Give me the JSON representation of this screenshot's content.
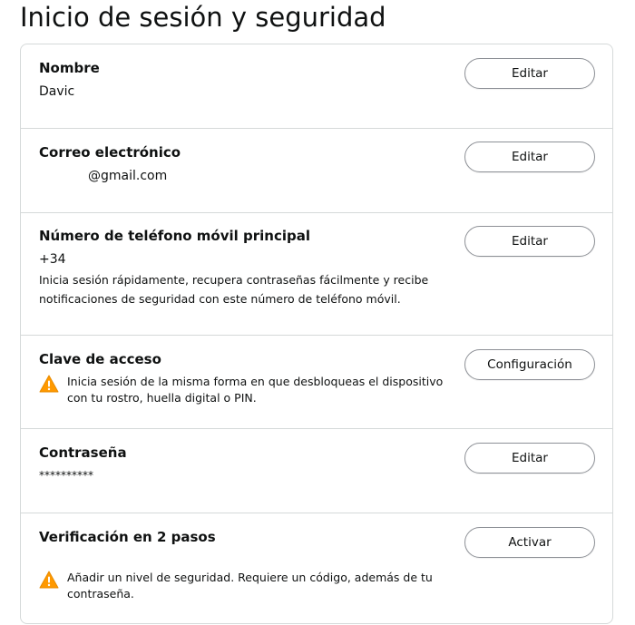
{
  "page": {
    "title": "Inicio de sesión y seguridad"
  },
  "colors": {
    "border": "#d5d9d9",
    "button_border": "#8d9096",
    "text": "#0f1111",
    "warning": "#ff9900"
  },
  "sections": {
    "name": {
      "title": "Nombre",
      "value": "Davic",
      "button": "Editar"
    },
    "email": {
      "title": "Correo electrónico",
      "value": "@gmail.com",
      "button": "Editar"
    },
    "phone": {
      "title": "Número de teléfono móvil principal",
      "value": "+34",
      "description": "Inicia sesión rápidamente, recupera contraseñas fácilmente y recibe notificaciones de seguridad con este número de teléfono móvil.",
      "button": "Editar"
    },
    "passkey": {
      "title": "Clave de acceso",
      "icon": "warning-icon",
      "description": "Inicia sesión de la misma forma en que desbloqueas el dispositivo con tu rostro, huella digital o PIN.",
      "button": "Configuración"
    },
    "password": {
      "title": "Contraseña",
      "value": "**********",
      "button": "Editar"
    },
    "two_step": {
      "title": "Verificación en 2 pasos",
      "icon": "warning-icon",
      "description": "Añadir un nivel de seguridad. Requiere un código, además de tu contraseña.",
      "button": "Activar"
    }
  }
}
